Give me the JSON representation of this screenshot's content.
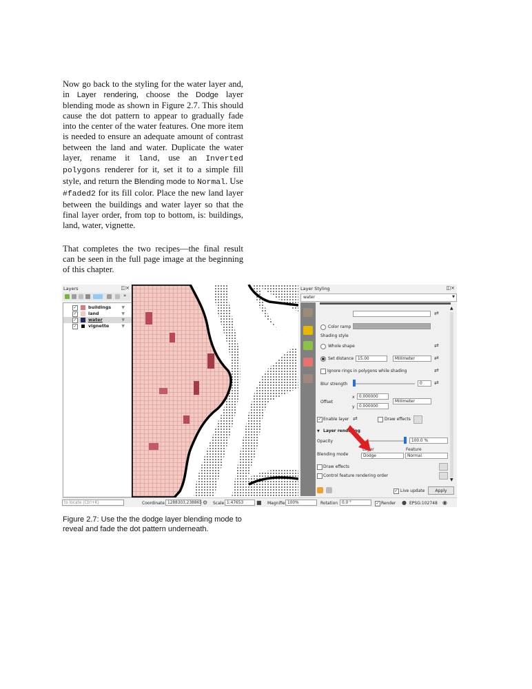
{
  "text": {
    "p1": [
      {
        "t": "Now go back to the styling for the water layer and, in "
      },
      {
        "t": "Layer rendering",
        "s": "sans"
      },
      {
        "t": ", choose the "
      },
      {
        "t": "Dodge",
        "s": "sans"
      },
      {
        "t": " layer blending mode as shown in Figure 2.7. This should cause the dot pattern to appear to gradually fade into the center of the water features. One more item is needed to ensure an adequate amount of contrast between the land and water. Duplicate the water layer, rename it "
      },
      {
        "t": "land",
        "s": "mono"
      },
      {
        "t": ", use an "
      },
      {
        "t": "Inverted polygons",
        "s": "mono"
      },
      {
        "t": " renderer for it, set it to a simple fill style, and return the "
      },
      {
        "t": "Blending mode",
        "s": "sans"
      },
      {
        "t": " to "
      },
      {
        "t": "Normal",
        "s": "mono"
      },
      {
        "t": ". Use "
      },
      {
        "t": "#faded2",
        "s": "mono"
      },
      {
        "t": " for its fill color. Place the new land layer between the buildings and water layer so that the final layer order, from top to bottom, is: buildings, land, water, vignette."
      }
    ],
    "p2": "That completes the two recipes—the final result can be seen in the full page image at the beginning of this chapter.",
    "caption": "Figure 2.7: Use the the dodge layer blending mode to reveal and fade the dot pattern underneath."
  },
  "screenshot": {
    "layers_panel": {
      "title": "Layers",
      "items": [
        {
          "name": "buildings",
          "color": "#e27878",
          "checked": true,
          "selected": false
        },
        {
          "name": "land",
          "color": "#f3c9c4",
          "checked": true,
          "selected": false
        },
        {
          "name": "water",
          "color": "#1f2d56",
          "checked": true,
          "selected": true
        },
        {
          "name": "vignette",
          "color": "#111111",
          "checked": true,
          "selected": false
        }
      ]
    },
    "style_panel": {
      "title": "Layer Styling",
      "layer": "water",
      "color_ramp": "Color ramp",
      "shading_style": "Shading style",
      "whole_shape": "Whole shape",
      "set_distance": "Set distance",
      "distance_value": "15.00",
      "distance_unit": "Millimeter",
      "ignore_rings": "Ignore rings in polygons while shading",
      "blur_strength": "Blur strength",
      "blur_value": "0",
      "offset": "Offset",
      "offset_x": "0.000000",
      "offset_y": "0.000000",
      "offset_x_label": "x",
      "offset_y_label": "y",
      "offset_unit": "Millimeter",
      "enable_layer": "Enable layer",
      "draw_effects": "Draw effects",
      "section_title": "Layer rendering",
      "opacity_label": "Opacity",
      "opacity_value": "100.0 %",
      "blending_mode": "Blending mode",
      "col_layer": "Layer",
      "col_feature": "Feature",
      "layer_mode": "Dodge",
      "feature_mode": "Normal",
      "draw_effects2": "Draw effects",
      "control_order": "Control feature rendering order",
      "live_update": "Live update",
      "apply": "Apply"
    },
    "status_bar": {
      "locate_placeholder": "to locate (Ctrl+K)",
      "coordinate_label": "Coordinate",
      "coordinate_value": "1288303,238865",
      "scale_label": "Scale",
      "scale_value": "1:47653",
      "magnifier_label": "Magnifier",
      "magnifier_value": "100%",
      "rotation_label": "Rotation",
      "rotation_value": "0.0 °",
      "render_label": "Render",
      "crs": "EPSG:102748"
    }
  }
}
